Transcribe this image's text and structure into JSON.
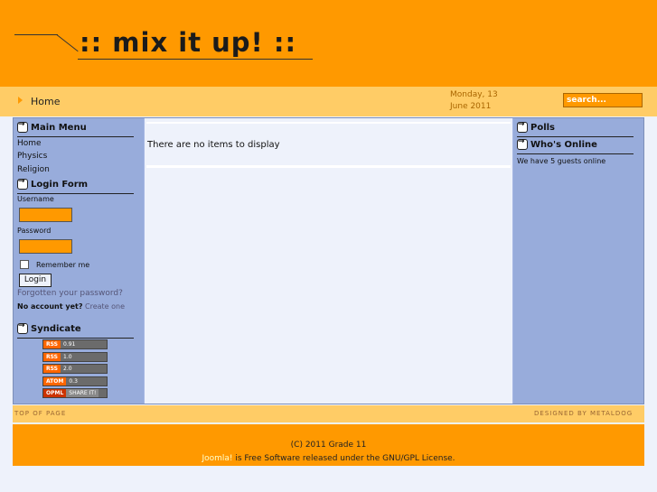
{
  "header": {
    "logo_text": ":: mix it up! ::"
  },
  "nav": {
    "home_label": "Home",
    "date_line1": "Monday, 13",
    "date_line2": "June 2011",
    "search_placeholder": "search..."
  },
  "left": {
    "main_menu": {
      "title": "Main Menu",
      "items": [
        "Home",
        "Physics",
        "Religion"
      ]
    },
    "login_form": {
      "title": "Login Form",
      "username_label": "Username",
      "password_label": "Password",
      "remember_label": "Remember me",
      "login_button": "Login",
      "forgot_link": "Forgotten your password?",
      "no_account_text": "No account yet?",
      "create_link": "Create one"
    },
    "syndicate": {
      "title": "Syndicate",
      "feeds": [
        {
          "tag": "RSS",
          "version": "0.91"
        },
        {
          "tag": "RSS",
          "version": "1.0"
        },
        {
          "tag": "RSS",
          "version": "2.0"
        },
        {
          "tag": "ATOM",
          "version": "0.3"
        },
        {
          "tag": "OPML",
          "version": "SHARE IT!"
        }
      ]
    }
  },
  "main": {
    "empty_message": "There are no items to display"
  },
  "right": {
    "polls_title": "Polls",
    "online_title": "Who's Online",
    "online_text": "We have 5 guests online"
  },
  "footbar": {
    "top_label": "TOP OF PAGE",
    "designed_label": "DESIGNED BY METALDOG"
  },
  "footer": {
    "copyright": "(C) 2011 Grade 11",
    "joomla_link": "Joomla!",
    "license_text": " is Free Software released under the GNU/GPL License."
  },
  "colors": {
    "accent": "#ff9900",
    "nav": "#ffcc66",
    "sidebar": "#98acdb"
  }
}
